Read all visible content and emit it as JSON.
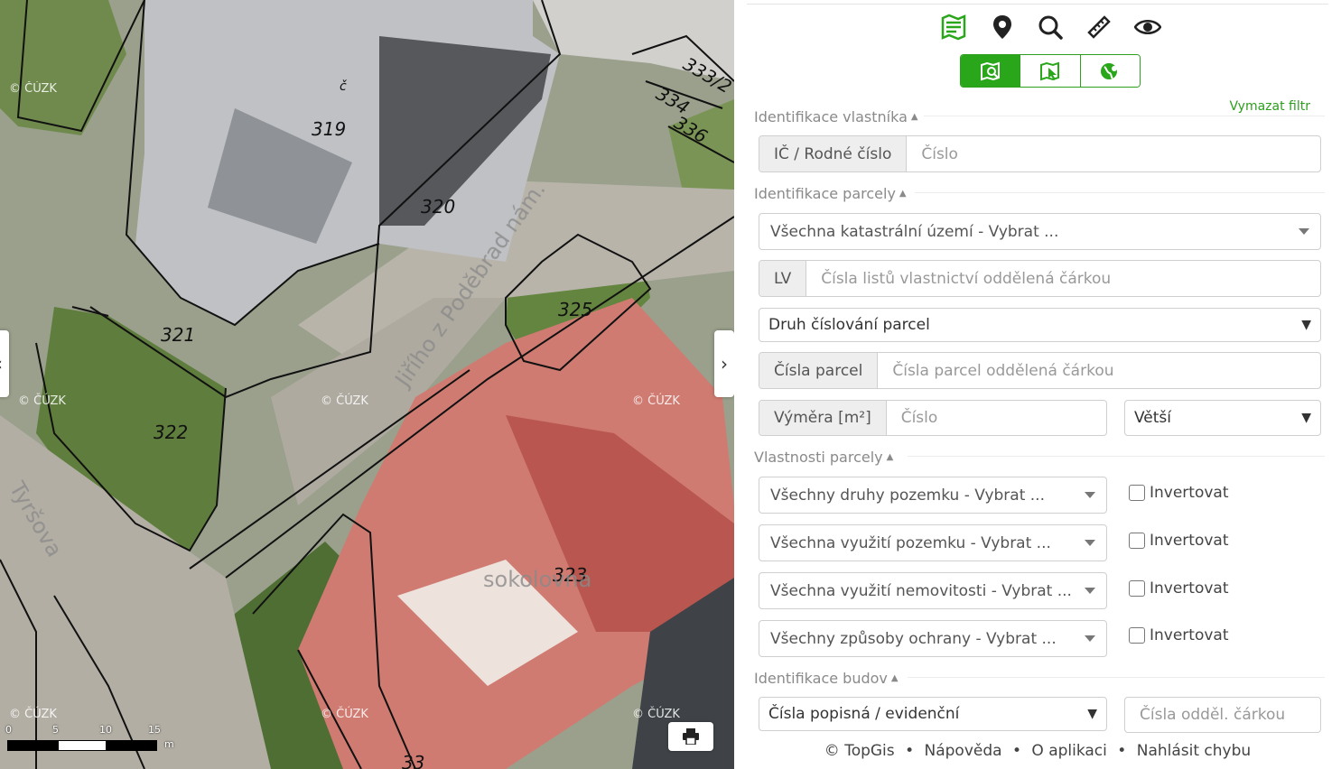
{
  "map": {
    "parcel_labels": [
      "319",
      "320",
      "321",
      "322",
      "323",
      "325",
      "333/2",
      "334",
      "336",
      "č",
      "33"
    ],
    "street_labels": [
      "Tyršova",
      "Jiřího ze Poděbrad nám.",
      "sokolovna"
    ],
    "watermark": "© ČÚZK",
    "scale": {
      "ticks": [
        "0",
        "5",
        "10",
        "15"
      ],
      "unit": "m"
    },
    "left_arrow": "‹",
    "right_arrow": "›"
  },
  "toolbar": {
    "icons": [
      "map-book-icon",
      "location-pin-icon",
      "search-icon",
      "measure-icon",
      "eye-icon"
    ],
    "sub_icons": [
      "map-search-icon",
      "map-select-icon",
      "globe-icon"
    ]
  },
  "clear_filter": "Vymazat filtr",
  "owner": {
    "title": "Identifikace vlastníka",
    "addon": "IČ / Rodné číslo",
    "placeholder": "Číslo"
  },
  "parcel": {
    "title": "Identifikace parcely",
    "cadastral_select": "Všechna katastrální území - Vybrat ...",
    "lv_addon": "LV",
    "lv_placeholder": "Čísla listů vlastnictví oddělená čárkou",
    "numbering_select": "Druh číslování parcel",
    "numbers_addon": "Čísla parcel",
    "numbers_placeholder": "Čísla parcel oddělená čárkou",
    "area_addon": "Výměra [m²]",
    "area_placeholder": "Číslo",
    "compare_select": "Větší"
  },
  "properties": {
    "title": "Vlastnosti parcely",
    "rows": [
      {
        "select": "Všechny druhy pozemku - Vybrat ...",
        "checkbox": "Invertovat"
      },
      {
        "select": "Všechna využití pozemku - Vybrat ...",
        "checkbox": "Invertovat"
      },
      {
        "select": "Všechna využití nemovitosti - Vybrat ...",
        "checkbox": "Invertovat"
      },
      {
        "select": "Všechny způsoby ochrany - Vybrat ...",
        "checkbox": "Invertovat"
      }
    ]
  },
  "buildings": {
    "title": "Identifikace budov",
    "type_select": "Čísla popisná / evidenční",
    "numbers_placeholder": "Čísla odděl. čárkou"
  },
  "footer": {
    "copyright": "© TopGis",
    "help": "Nápověda",
    "about": "O aplikaci",
    "report": "Nahlásit chybu",
    "separator": "•"
  },
  "colors": {
    "accent": "#2aa61b",
    "roof_red": "#c96b66",
    "vegetation": "#5d7a3f"
  }
}
